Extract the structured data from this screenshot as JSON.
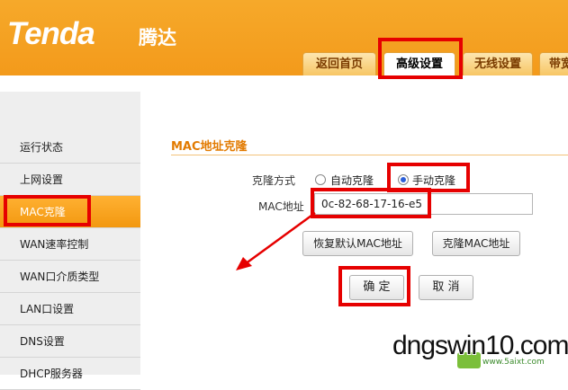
{
  "brand": {
    "logo": "Tenda",
    "logo_cn": "腾达"
  },
  "tabs": [
    {
      "label": "返回首页"
    },
    {
      "label": "高级设置",
      "active": true
    },
    {
      "label": "无线设置"
    },
    {
      "label": "带宽"
    }
  ],
  "sidebar": {
    "items": [
      {
        "label": "运行状态"
      },
      {
        "label": "上网设置"
      },
      {
        "label": "MAC克隆",
        "active": true
      },
      {
        "label": "WAN速率控制"
      },
      {
        "label": "WAN口介质类型"
      },
      {
        "label": "LAN口设置"
      },
      {
        "label": "DNS设置"
      },
      {
        "label": "DHCP服务器"
      }
    ]
  },
  "main": {
    "title": "MAC地址克隆",
    "clone_mode_label": "克隆方式",
    "radio_auto": "自动克隆",
    "radio_manual": "手动克隆",
    "selected_mode": "手动克隆",
    "mac_label": "MAC地址",
    "mac_value": "0c-82-68-17-16-e5",
    "restore_button": "恢复默认MAC地址",
    "clone_button": "克隆MAC地址",
    "ok_button": "确 定",
    "cancel_button": "取 消"
  },
  "watermark": {
    "text": "dngswin10.com",
    "sub": "www.5aixt.com"
  },
  "colors": {
    "header": "#f39a1b",
    "highlight": "#e60000",
    "title": "#e27a00"
  }
}
